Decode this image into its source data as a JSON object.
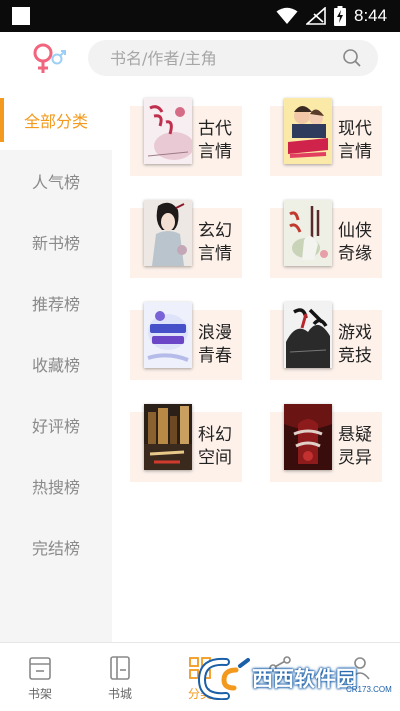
{
  "status_bar": {
    "time": "8:44",
    "icons": [
      "notification-square-icon",
      "wifi-icon",
      "signal-off-icon",
      "battery-charging-icon"
    ]
  },
  "header": {
    "search_placeholder": "书名/作者/主角",
    "gender_icon": "gender-switch-icon",
    "search_icon": "search-icon"
  },
  "colors": {
    "accent": "#f39a1e",
    "card_bg": "#fdf1ea",
    "sidebar_bg": "#f5f5f5",
    "pink": "#f2657e",
    "blue": "#4ca7f0"
  },
  "sidebar": {
    "items": [
      {
        "label": "全部分类",
        "active": true
      },
      {
        "label": "人气榜",
        "active": false
      },
      {
        "label": "新书榜",
        "active": false
      },
      {
        "label": "推荐榜",
        "active": false
      },
      {
        "label": "收藏榜",
        "active": false
      },
      {
        "label": "好评榜",
        "active": false
      },
      {
        "label": "热搜榜",
        "active": false
      },
      {
        "label": "完结榜",
        "active": false
      }
    ]
  },
  "categories": [
    {
      "line1": "古代",
      "line2": "言情",
      "cover_title": "权宠天下"
    },
    {
      "line1": "现代",
      "line2": "言情",
      "cover_title": "野性老公请深爱"
    },
    {
      "line1": "玄幻",
      "line2": "言情",
      "cover_title": ""
    },
    {
      "line1": "仙侠",
      "line2": "奇缘",
      "cover_title": "风舞天下"
    },
    {
      "line1": "浪漫",
      "line2": "青春",
      "cover_title": "电竞男神恋爱吧"
    },
    {
      "line1": "游戏",
      "line2": "竞技",
      "cover_title": ""
    },
    {
      "line1": "科幻",
      "line2": "空间",
      "cover_title": "科技解约了"
    },
    {
      "line1": "悬疑",
      "line2": "灵异",
      "cover_title": ""
    }
  ],
  "bottom_nav": {
    "items": [
      {
        "label": "书架",
        "icon": "bookshelf-icon",
        "active": false
      },
      {
        "label": "书城",
        "icon": "bookstore-icon",
        "active": false
      },
      {
        "label": "分类",
        "icon": "category-icon",
        "active": true
      },
      {
        "label": "",
        "icon": "share-icon",
        "active": false
      },
      {
        "label": "",
        "icon": "profile-icon",
        "active": false
      }
    ]
  },
  "watermark": {
    "text": "西西软件园",
    "sub": "CR173.COM"
  }
}
